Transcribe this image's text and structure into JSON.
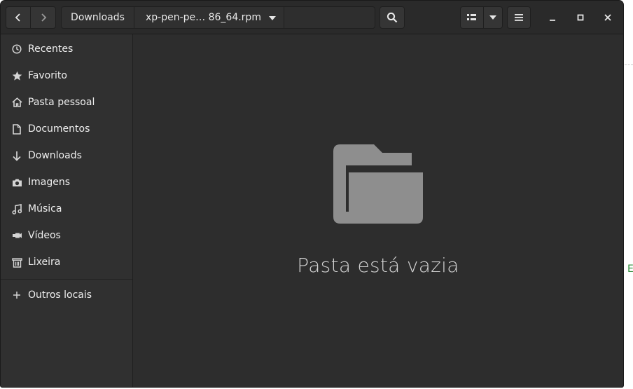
{
  "headerbar": {
    "path": [
      "Downloads",
      "xp-pen-pe… 86_64.rpm"
    ]
  },
  "sidebar": {
    "items": [
      {
        "label": "Recentes",
        "icon": "clock-icon"
      },
      {
        "label": "Favorito",
        "icon": "star-icon"
      },
      {
        "label": "Pasta pessoal",
        "icon": "home-icon"
      },
      {
        "label": "Documentos",
        "icon": "document-icon"
      },
      {
        "label": "Downloads",
        "icon": "download-arrow-icon"
      },
      {
        "label": "Imagens",
        "icon": "camera-icon"
      },
      {
        "label": "Música",
        "icon": "music-note-icon"
      },
      {
        "label": "Vídeos",
        "icon": "video-icon"
      },
      {
        "label": "Lixeira",
        "icon": "trash-icon"
      }
    ],
    "other_locations": {
      "label": "Outros locais",
      "icon": "plus-icon"
    }
  },
  "main": {
    "empty_message": "Pasta está vazia",
    "empty_icon": "folder-icon"
  },
  "background": {
    "partial_letter": "E"
  },
  "colors": {
    "window_bg": "#2d2d2d",
    "sidebar_bg": "#303030",
    "headerbar_bg": "#2a2a2a",
    "folder_icon": "#8e8e8e"
  }
}
